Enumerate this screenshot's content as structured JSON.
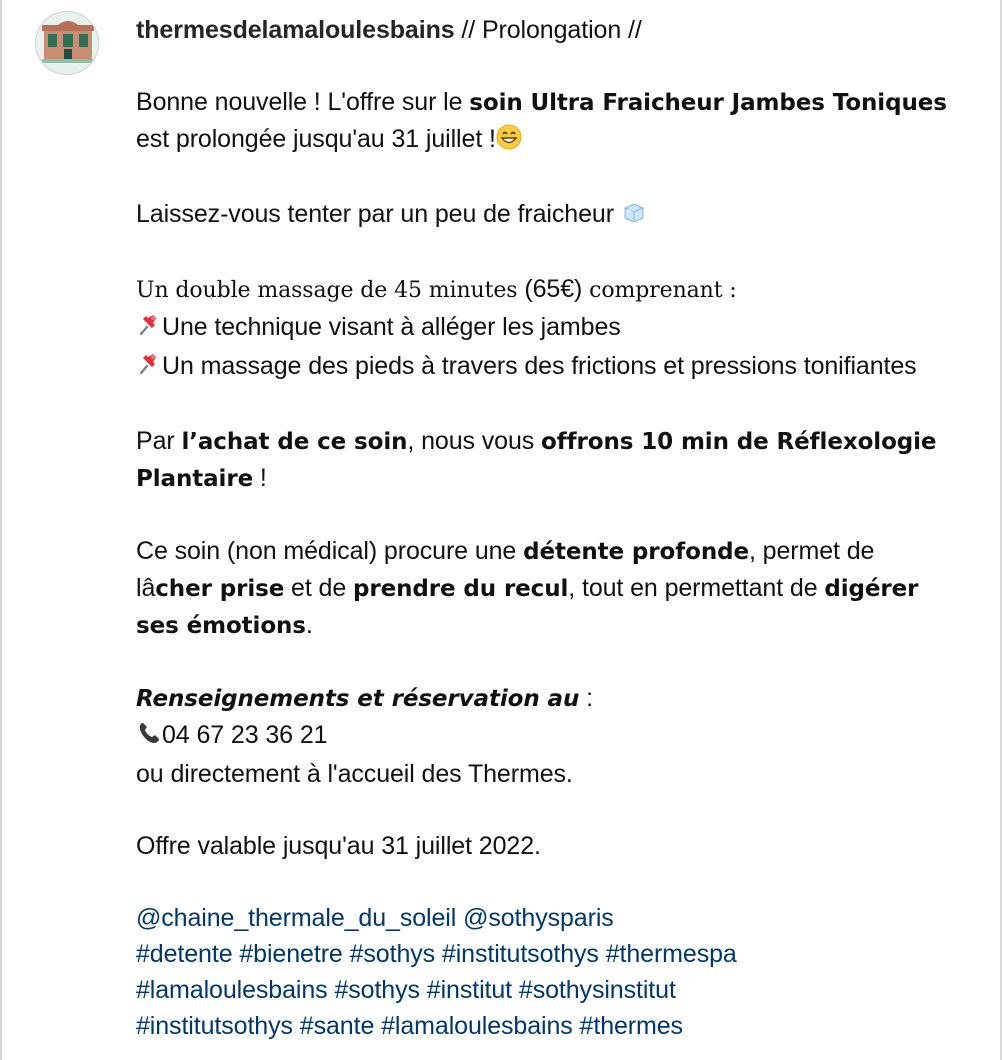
{
  "post": {
    "username": "thermesdelamaloulesbains",
    "avatar_icon": "thermes-building-logo-icon",
    "title": " // Prolongation //"
  },
  "caption": {
    "p1_a": "Bonne nouvelle ! L'offre sur le ",
    "p1_b": "soin Ultra Fraicheur Jambes Toniques",
    "p1_c": " est prolongée jusqu'au 31 juillet !",
    "p1_emoji": "grinning-face-icon",
    "p2": "Laissez-vous tenter par un peu de fraicheur ",
    "p2_emoji": "ice-cube-icon",
    "p3_line1_a": "Un double massage de 45 minutes ",
    "p3_line1_b": "(65€)",
    "p3_line1_c": " comprenant :",
    "bullet_icon": "pushpin-icon",
    "p3_bullet1": "Une technique visant à alléger les jambes",
    "p3_bullet2": "Un massage des pieds à travers des frictions et pressions tonifiantes",
    "p4_a": "Par ",
    "p4_b": "l’achat de ce soin",
    "p4_c": ", nous vous ",
    "p4_d": "offrons 10 min de Réflexologie Plantaire",
    "p4_e": " !",
    "p5_a": "Ce soin (non médical) procure une ",
    "p5_b": "détente profonde",
    "p5_c": ", permet de lâ",
    "p5_d": "cher prise",
    "p5_e": " et de ",
    "p5_f": "prendre du recul",
    "p5_g": ", tout en permettant de ",
    "p5_h": "digérer ses émotions",
    "p5_i": ".",
    "p6_label": "Renseignements et réservation au",
    "p6_colon": " :",
    "phone_icon": "telephone-receiver-icon",
    "phone": "04 67 23 36 21",
    "p6_line3": "ou directement à l'accueil des Thermes.",
    "p7": "Offre valable jusqu'au 31 juillet 2022.",
    "mentions": [
      "@chaine_thermale_du_soleil",
      "@sothysparis"
    ],
    "hashtags_line1": [
      "#detente",
      "#bienetre",
      "#sothys",
      "#institutsothys",
      "#thermespa"
    ],
    "hashtags_line2": [
      "#lamaloulesbains",
      "#sothys",
      "#institut",
      "#sothysinstitut"
    ],
    "hashtags_line3": [
      "#institutsothys",
      "#sante",
      "#lamaloulesbains",
      "#thermes"
    ]
  },
  "colors": {
    "text": "#111111",
    "username": "#262626",
    "link": "#00376b",
    "frame": "#d9d9d9"
  }
}
